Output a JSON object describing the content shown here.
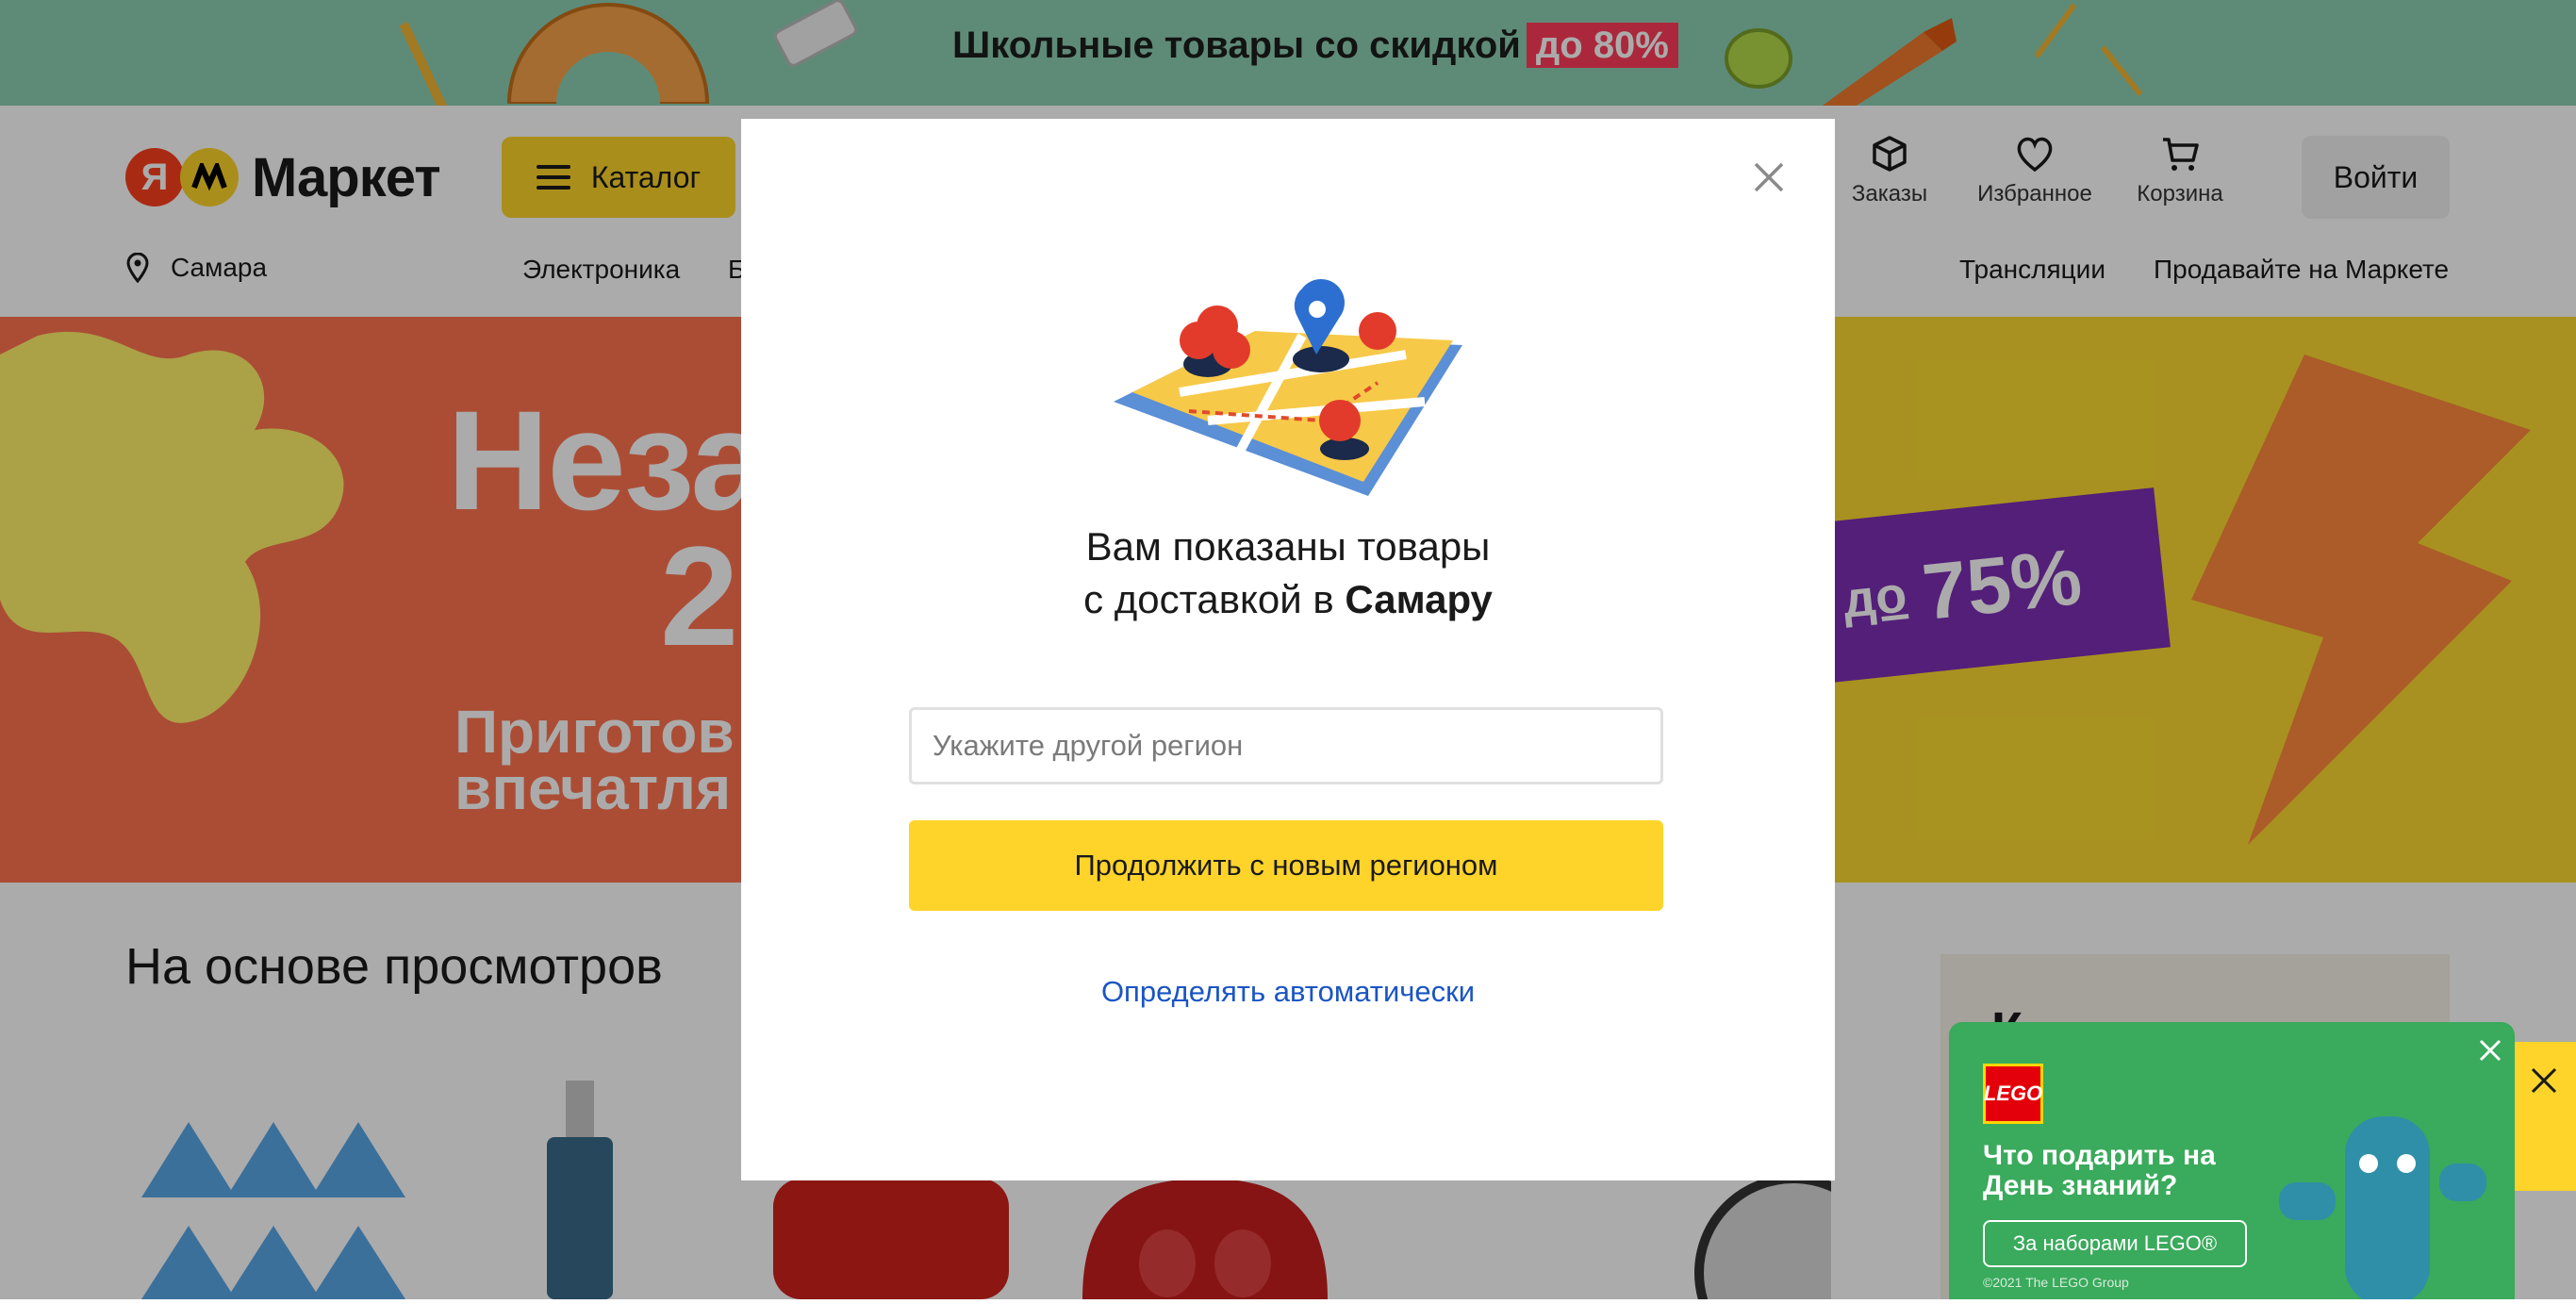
{
  "promo": {
    "text": "Школьные товары со скидкой",
    "accent": "до 80%"
  },
  "header": {
    "logo_ya": "Я",
    "logo_text": "Маркет",
    "catalog_label": "Каталог",
    "icons": {
      "orders": "Заказы",
      "favorites": "Избранное",
      "cart": "Корзина"
    },
    "login_label": "Войти",
    "city": "Самара",
    "nav": {
      "electronics": "Электроника",
      "b_partial": "Б",
      "broadcasts": "Трансляции",
      "sell": "Продавайте на Маркете"
    }
  },
  "banner": {
    "title_partial": "Неза",
    "number_partial": "2",
    "subtitle_line1": "Приготов",
    "subtitle_line2": "впечатля",
    "discount_prefix": "до",
    "discount_value": "75%"
  },
  "feed": {
    "title": "На основе просмотров",
    "side_heading_partial": "К"
  },
  "lego_toast": {
    "logo": "LEGO",
    "title": "Что подарить на День знаний?",
    "button": "За наборами LEGO®",
    "copyright": "©2021 The LEGO Group"
  },
  "modal": {
    "line1": "Вам показаны товары",
    "line2_prefix": "с доставкой в",
    "line2_city": "Самару",
    "input_placeholder": "Укажите другой регион",
    "input_value": "",
    "continue_label": "Продолжить с новым регионом",
    "auto_label": "Определять автоматически"
  },
  "colors": {
    "brand_yellow": "#fed42b",
    "promo_green": "#8cd0b4",
    "banner_orange": "#ff7350",
    "link_blue": "#1a55c4",
    "logo_red": "#fc3f1d",
    "lego_green": "#3aaa5c"
  }
}
